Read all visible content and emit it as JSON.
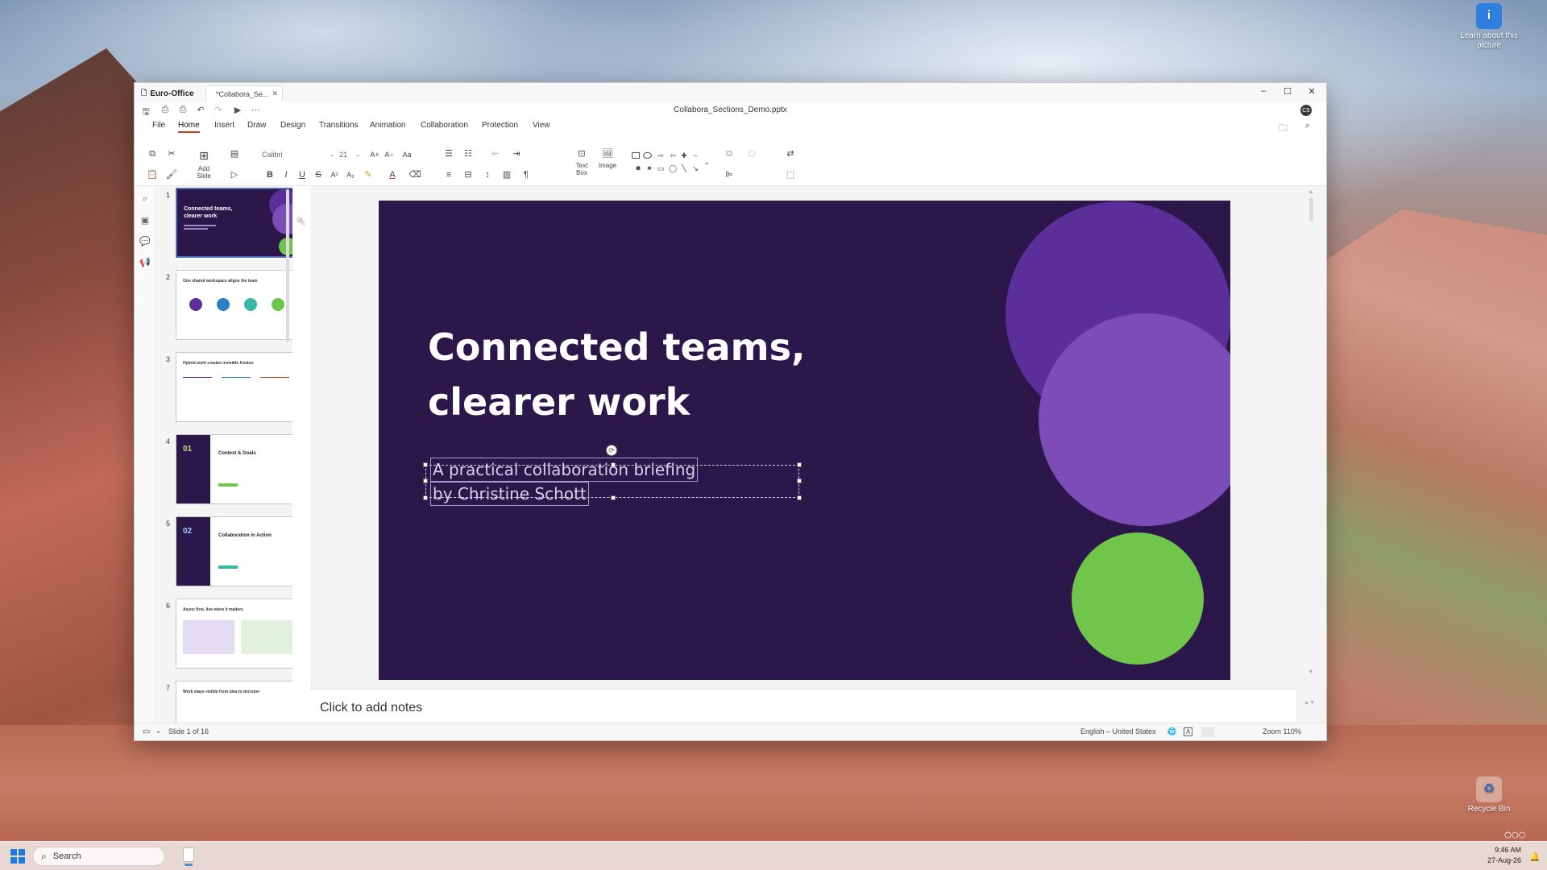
{
  "desktop": {
    "icons": [
      {
        "label": "Learn about this picture",
        "icon": "info-picture-icon"
      },
      {
        "label": "Recycle Bin",
        "icon": "recycle-bin-icon"
      }
    ]
  },
  "taskbar": {
    "search_placeholder": "Search",
    "time": "9:46 AM",
    "date": "27-Aug-26"
  },
  "window": {
    "app_name": "Euro-Office",
    "doc_tab_label": "*Collabora_Se...",
    "doc_title": "Collabora_Sections_Demo.pptx",
    "avatar_initials": "CS",
    "menu": [
      "File",
      "Home",
      "Insert",
      "Draw",
      "Design",
      "Transitions",
      "Animation",
      "Collaboration",
      "Protection",
      "View"
    ],
    "active_menu": "Home"
  },
  "ribbon": {
    "font_name": "Calibri",
    "font_size": "21",
    "add_slide_label": "Add Slide",
    "text_box_label": "Text Box",
    "image_label": "Image"
  },
  "thumbnails": [
    {
      "num": "1",
      "title": "Connected teams, clearer work"
    },
    {
      "num": "2",
      "title": "One shared workspace aligns the team"
    },
    {
      "num": "3",
      "title": "Hybrid work creates invisible friction"
    },
    {
      "num": "4",
      "title": "Context & Goals",
      "badge": "01"
    },
    {
      "num": "5",
      "title": "Collaboration in Action",
      "badge": "02"
    },
    {
      "num": "6",
      "title": "Async first, live when it matters"
    },
    {
      "num": "7",
      "title": "Work stays visible from idea to decision"
    }
  ],
  "slide": {
    "title_line1": "Connected teams,",
    "title_line2": "clearer work",
    "subtitle_line1": "A practical collaboration briefing",
    "subtitle_line2": "by Christine Schott",
    "colors": {
      "background": "#2b174a",
      "circle_dark_purple": "#5c2e9a",
      "circle_light_purple": "#7c4db6",
      "circle_green": "#6fc64a"
    }
  },
  "notes": {
    "placeholder": "Click to add notes"
  },
  "status": {
    "slide_info": "Slide 1 of 16",
    "language": "English – United States",
    "zoom": "Zoom 110%"
  }
}
